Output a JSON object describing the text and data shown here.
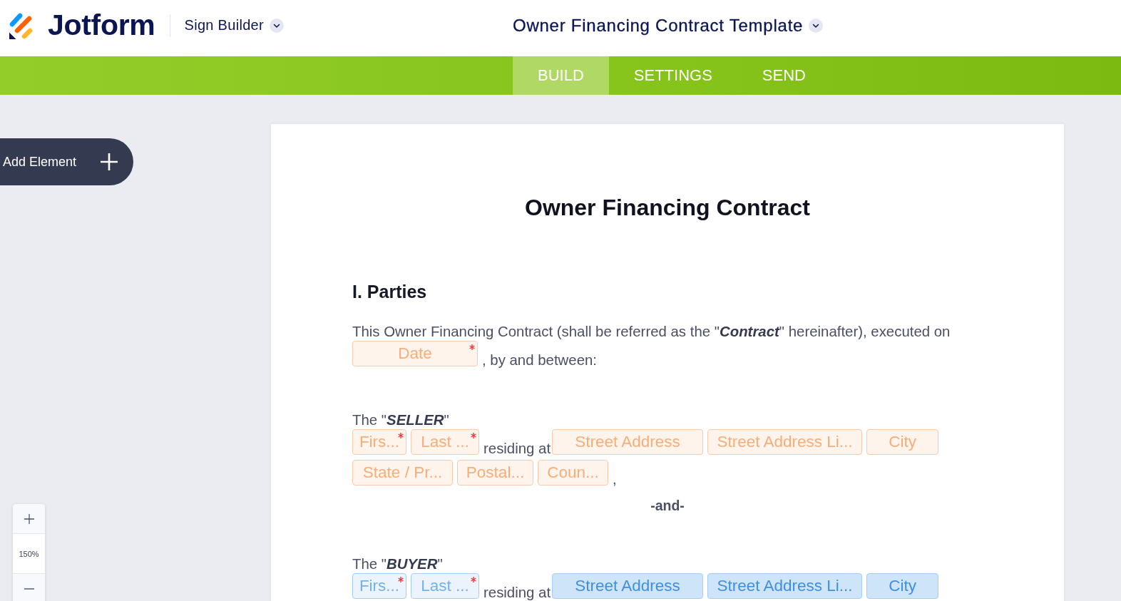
{
  "header": {
    "brand": "Jotform",
    "product": "Sign Builder",
    "document_title": "Owner Financing Contract Template"
  },
  "tabs": [
    {
      "label": "BUILD",
      "selected": true
    },
    {
      "label": "SETTINGS",
      "selected": false
    },
    {
      "label": "SEND",
      "selected": false
    }
  ],
  "add_element": {
    "label": "Add Element"
  },
  "zoom": {
    "value": "150%"
  },
  "document": {
    "title": "Owner Financing Contract",
    "heading": "I. Parties",
    "intro": {
      "text": "This Owner Financing Contract (shall be referred as the \"**Contract**\" hereinafter), executed on",
      "date_field": {
        "kind": "date",
        "label": "Date",
        "required": true,
        "selected": false
      },
      "after": ", by and between:"
    },
    "separator": "-and-",
    "parties": [
      {
        "label": "The \"**SELLER**\"",
        "color": "#f5ae7a",
        "items": [
          {
            "kind": "first_name",
            "label": "Firs...",
            "required": true,
            "selected": false
          },
          {
            "kind": "last_name",
            "label": "Last ...",
            "required": true,
            "selected": false
          },
          {
            "kind": "text",
            "text": "residing at"
          },
          {
            "kind": "street",
            "label": "Street Address",
            "required": false,
            "selected": false
          },
          {
            "kind": "street_line2",
            "label": "Street Address Li...",
            "required": false,
            "selected": false
          },
          {
            "kind": "city",
            "label": "City",
            "required": false,
            "selected": false
          },
          {
            "kind": "state",
            "label": "State / Pr...",
            "required": false,
            "selected": false
          },
          {
            "kind": "postal",
            "label": "Postal...",
            "required": false,
            "selected": false
          },
          {
            "kind": "country",
            "label": "Coun...",
            "required": false,
            "selected": false
          },
          {
            "kind": "text",
            "text": ","
          }
        ]
      },
      {
        "label": "The \"**BUYER**\"",
        "color": "#74b1ed",
        "items": [
          {
            "kind": "first_name",
            "label": "Firs...",
            "required": true,
            "selected": false
          },
          {
            "kind": "last_name",
            "label": "Last ...",
            "required": true,
            "selected": false
          },
          {
            "kind": "text",
            "text": "residing at"
          },
          {
            "kind": "street",
            "label": "Street Address",
            "required": false,
            "selected": true
          },
          {
            "kind": "street_line2",
            "label": "Street Address Li...",
            "required": false,
            "selected": true
          },
          {
            "kind": "city",
            "label": "City",
            "required": false,
            "selected": true
          }
        ]
      }
    ]
  }
}
